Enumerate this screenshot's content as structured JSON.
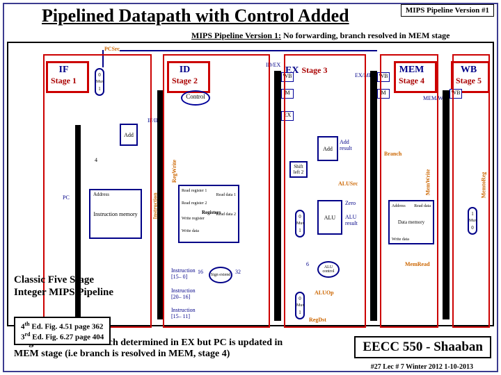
{
  "title": "Pipelined Datapath with Control Added",
  "version_box": "MIPS Pipeline Version #1",
  "subtitle_u": "MIPS Pipeline Version 1:",
  "subtitle_rest": " No forwarding, branch resolved in MEM stage",
  "stages": {
    "if": {
      "name": "IF",
      "sub": "Stage 1"
    },
    "id": {
      "name": "ID",
      "sub": "Stage 2"
    },
    "ex": {
      "name": "EX",
      "sub": "Stage 3"
    },
    "mem": {
      "name": "MEM",
      "sub": "Stage 4"
    },
    "wb": {
      "name": "WB",
      "sub": "Stage 5"
    }
  },
  "reg_labels": {
    "pcsrc": "PCSrc",
    "ifid": "IF/ID",
    "idex": "ID/EX",
    "exmem": "EX/MEM",
    "memwb": "MEM/WB"
  },
  "control_oval": "Control",
  "ctrl_segments": {
    "wb1": "WB",
    "m1": "M",
    "ex1": "EX",
    "wb2": "WB",
    "m2": "M",
    "wb3": "WB"
  },
  "blocks": {
    "add1": "Add",
    "const4": "4",
    "add2": "Add",
    "add_result": "Add result",
    "shift": "Shift left 2",
    "pc": "PC",
    "address1": "Address",
    "imem": "Instruction memory",
    "read_reg1": "Read register 1",
    "read_reg2": "Read register 2",
    "write_reg": "Write register",
    "write_data1": "Write data",
    "registers": "Registers",
    "read_data1": "Read data 1",
    "read_data2": "Read data 2",
    "zero": "Zero",
    "alu": "ALU",
    "alu_result": "ALU result",
    "alu_control": "ALU control",
    "sign_ext": "Sign extend",
    "address2": "Address",
    "dmem": "Data memory",
    "write_data2": "Write data",
    "read_data3": "Read data",
    "inst15_0": "Instruction [15– 0]",
    "inst20_16": "Instruction [20– 16]",
    "inst15_11": "Instruction [15– 11]",
    "num16": "16",
    "num32": "32",
    "num6": "6",
    "mux": "Mux",
    "mux0": "0",
    "mux1": "1"
  },
  "signals": {
    "regwrite": "RegWrite",
    "instruction": "Instruction",
    "branch": "Branch",
    "alusrc": "ALUSrc",
    "memwrite": "MemWrite",
    "memtoreg": "MemtoReg",
    "memread": "MemRead",
    "aluop": "ALUOp",
    "regdst": "RegDst"
  },
  "classic_box": "Classic Five Stage Integer MIPS Pipeline",
  "edition_line1": "4th Ed. Fig. 4.51 page 362",
  "edition_line2": "3rd Ed. Fig. 6.27 page 404",
  "target_text": "Target address of branch determined in EX but PC is updated in MEM stage (i.e branch is resolved in MEM, stage 4)",
  "course": "EECC 550 - Shaaban",
  "footer": "#27 Lec # 7 Winter 2012 1-10-2013"
}
